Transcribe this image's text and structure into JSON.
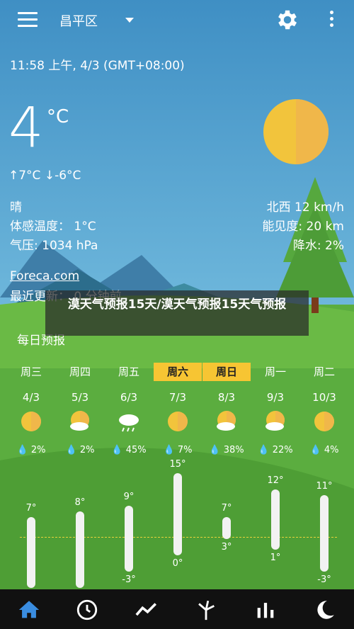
{
  "header": {
    "location": "昌平区"
  },
  "current": {
    "datetime": "11:58 上午, 4/3 (GMT+08:00)",
    "temperature": "4",
    "unit": "°C",
    "hi_lo": "↑7°C ↓-6°C",
    "condition": "晴",
    "feels_like": "体感温度： 1°C",
    "pressure": "气压: 1034 hPa",
    "wind": "北西 12 km/h",
    "visibility": "能见度: 20 km",
    "precipitation": "降水: 2%",
    "source": "Foreca.com",
    "updated": "最近更新： 0 分钟前"
  },
  "overlay_text": "漠天气预报15天/漠天气预报15天气预报",
  "forecast": {
    "title": "每日预报",
    "days": [
      {
        "name": "周三",
        "date": "4/3",
        "icon": "sun-icon",
        "rain": "2%",
        "hi": "7°",
        "lo": "",
        "hi_val": 7,
        "lo_val": -6
      },
      {
        "name": "周四",
        "date": "5/3",
        "icon": "partly-cloudy-icon",
        "rain": "2%",
        "hi": "8°",
        "lo": "",
        "hi_val": 8,
        "lo_val": -6
      },
      {
        "name": "周五",
        "date": "6/3",
        "icon": "rain-cloud-icon",
        "rain": "45%",
        "hi": "9°",
        "lo": "-3°",
        "hi_val": 9,
        "lo_val": -3
      },
      {
        "name": "周六",
        "date": "7/3",
        "icon": "sun-icon",
        "rain": "7%",
        "hi": "15°",
        "lo": "0°",
        "hi_val": 15,
        "lo_val": 0
      },
      {
        "name": "周日",
        "date": "8/3",
        "icon": "partly-cloudy-icon",
        "rain": "38%",
        "hi": "7°",
        "lo": "3°",
        "hi_val": 7,
        "lo_val": 3
      },
      {
        "name": "周一",
        "date": "9/3",
        "icon": "partly-cloudy-icon",
        "rain": "22%",
        "hi": "12°",
        "lo": "1°",
        "hi_val": 12,
        "lo_val": 1
      },
      {
        "name": "周二",
        "date": "10/3",
        "icon": "sun-icon",
        "rain": "4%",
        "hi": "11°",
        "lo": "-3°",
        "hi_val": 11,
        "lo_val": -3
      }
    ]
  },
  "nav": [
    "home-icon",
    "clock-icon",
    "graph-icon",
    "wind-turbine-icon",
    "bars-icon",
    "moon-icon"
  ],
  "colors": {
    "sky": "#4a9fd0",
    "grass": "#5cae3e",
    "weekend": "#f7c533",
    "sun": "#f2c43c",
    "nav_active": "#3a8de0"
  }
}
